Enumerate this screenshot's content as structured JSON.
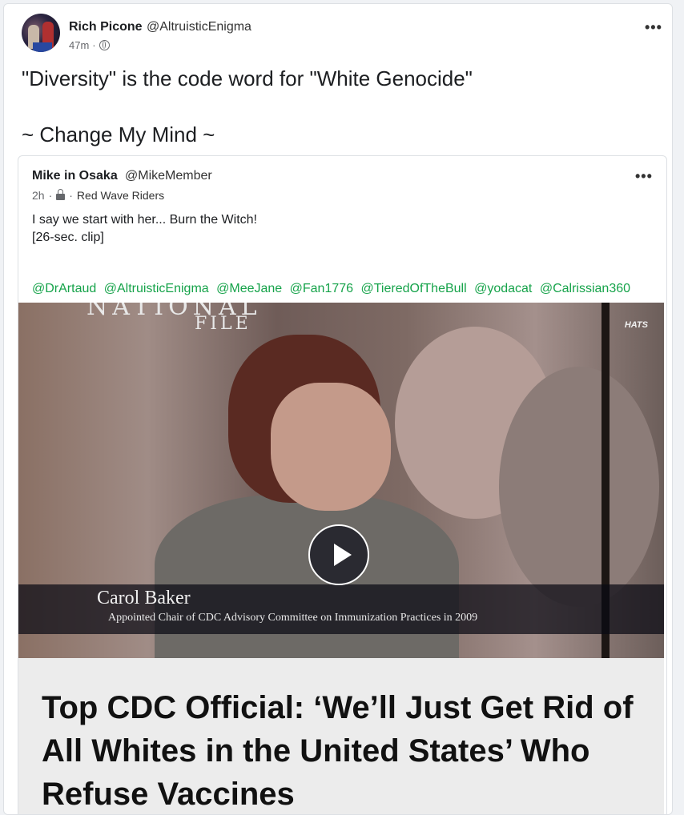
{
  "post": {
    "author_name": "Rich Picone",
    "author_handle": "@AltruisticEnigma",
    "time": "47m",
    "separator": "·",
    "visibility_icon": "globe-icon",
    "more_label": "•••",
    "text_line1": "\"Diversity\" is the code word for \"White Genocide\"",
    "text_line2": "~ Change My Mind ~"
  },
  "quoted": {
    "author_name": "Mike in Osaka",
    "author_handle": "@MikeMember",
    "time": "2h",
    "separator": "·",
    "group_icon": "lock-icon",
    "group": "Red Wave Riders",
    "more_label": "•••",
    "body_line1": "I say we start with her... Burn the Witch!",
    "body_line2": "[26-sec. clip]",
    "mentions": [
      "@DrArtaud",
      "@AltruisticEnigma",
      "@MeeJane",
      "@Fan1776",
      "@TieredOfTheBull",
      "@yodacat",
      "@Calrissian360"
    ]
  },
  "video": {
    "logo_top": "NATIONAL",
    "logo_bottom": "FILE",
    "watermark": "HATS",
    "caption_name": "Carol Baker",
    "caption_title": "Appointed Chair of CDC Advisory Committee on Immunization Practices in 2009",
    "play_icon": "play-icon",
    "headline": "Top CDC Official: ‘We’ll Just Get Rid of All Whites in the United States’ Who Refuse Vaccines"
  },
  "colors": {
    "mention": "#16a34a",
    "background": "#f0f2f5",
    "card": "#ffffff"
  }
}
